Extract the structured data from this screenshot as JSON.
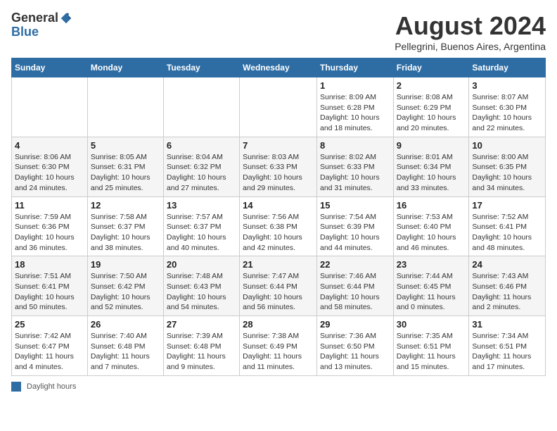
{
  "header": {
    "logo_general": "General",
    "logo_blue": "Blue",
    "month_title": "August 2024",
    "location": "Pellegrini, Buenos Aires, Argentina"
  },
  "days_of_week": [
    "Sunday",
    "Monday",
    "Tuesday",
    "Wednesday",
    "Thursday",
    "Friday",
    "Saturday"
  ],
  "weeks": [
    [
      {
        "day": "",
        "info": ""
      },
      {
        "day": "",
        "info": ""
      },
      {
        "day": "",
        "info": ""
      },
      {
        "day": "",
        "info": ""
      },
      {
        "day": "1",
        "info": "Sunrise: 8:09 AM\nSunset: 6:28 PM\nDaylight: 10 hours and 18 minutes."
      },
      {
        "day": "2",
        "info": "Sunrise: 8:08 AM\nSunset: 6:29 PM\nDaylight: 10 hours and 20 minutes."
      },
      {
        "day": "3",
        "info": "Sunrise: 8:07 AM\nSunset: 6:30 PM\nDaylight: 10 hours and 22 minutes."
      }
    ],
    [
      {
        "day": "4",
        "info": "Sunrise: 8:06 AM\nSunset: 6:30 PM\nDaylight: 10 hours and 24 minutes."
      },
      {
        "day": "5",
        "info": "Sunrise: 8:05 AM\nSunset: 6:31 PM\nDaylight: 10 hours and 25 minutes."
      },
      {
        "day": "6",
        "info": "Sunrise: 8:04 AM\nSunset: 6:32 PM\nDaylight: 10 hours and 27 minutes."
      },
      {
        "day": "7",
        "info": "Sunrise: 8:03 AM\nSunset: 6:33 PM\nDaylight: 10 hours and 29 minutes."
      },
      {
        "day": "8",
        "info": "Sunrise: 8:02 AM\nSunset: 6:33 PM\nDaylight: 10 hours and 31 minutes."
      },
      {
        "day": "9",
        "info": "Sunrise: 8:01 AM\nSunset: 6:34 PM\nDaylight: 10 hours and 33 minutes."
      },
      {
        "day": "10",
        "info": "Sunrise: 8:00 AM\nSunset: 6:35 PM\nDaylight: 10 hours and 34 minutes."
      }
    ],
    [
      {
        "day": "11",
        "info": "Sunrise: 7:59 AM\nSunset: 6:36 PM\nDaylight: 10 hours and 36 minutes."
      },
      {
        "day": "12",
        "info": "Sunrise: 7:58 AM\nSunset: 6:37 PM\nDaylight: 10 hours and 38 minutes."
      },
      {
        "day": "13",
        "info": "Sunrise: 7:57 AM\nSunset: 6:37 PM\nDaylight: 10 hours and 40 minutes."
      },
      {
        "day": "14",
        "info": "Sunrise: 7:56 AM\nSunset: 6:38 PM\nDaylight: 10 hours and 42 minutes."
      },
      {
        "day": "15",
        "info": "Sunrise: 7:54 AM\nSunset: 6:39 PM\nDaylight: 10 hours and 44 minutes."
      },
      {
        "day": "16",
        "info": "Sunrise: 7:53 AM\nSunset: 6:40 PM\nDaylight: 10 hours and 46 minutes."
      },
      {
        "day": "17",
        "info": "Sunrise: 7:52 AM\nSunset: 6:41 PM\nDaylight: 10 hours and 48 minutes."
      }
    ],
    [
      {
        "day": "18",
        "info": "Sunrise: 7:51 AM\nSunset: 6:41 PM\nDaylight: 10 hours and 50 minutes."
      },
      {
        "day": "19",
        "info": "Sunrise: 7:50 AM\nSunset: 6:42 PM\nDaylight: 10 hours and 52 minutes."
      },
      {
        "day": "20",
        "info": "Sunrise: 7:48 AM\nSunset: 6:43 PM\nDaylight: 10 hours and 54 minutes."
      },
      {
        "day": "21",
        "info": "Sunrise: 7:47 AM\nSunset: 6:44 PM\nDaylight: 10 hours and 56 minutes."
      },
      {
        "day": "22",
        "info": "Sunrise: 7:46 AM\nSunset: 6:44 PM\nDaylight: 10 hours and 58 minutes."
      },
      {
        "day": "23",
        "info": "Sunrise: 7:44 AM\nSunset: 6:45 PM\nDaylight: 11 hours and 0 minutes."
      },
      {
        "day": "24",
        "info": "Sunrise: 7:43 AM\nSunset: 6:46 PM\nDaylight: 11 hours and 2 minutes."
      }
    ],
    [
      {
        "day": "25",
        "info": "Sunrise: 7:42 AM\nSunset: 6:47 PM\nDaylight: 11 hours and 4 minutes."
      },
      {
        "day": "26",
        "info": "Sunrise: 7:40 AM\nSunset: 6:48 PM\nDaylight: 11 hours and 7 minutes."
      },
      {
        "day": "27",
        "info": "Sunrise: 7:39 AM\nSunset: 6:48 PM\nDaylight: 11 hours and 9 minutes."
      },
      {
        "day": "28",
        "info": "Sunrise: 7:38 AM\nSunset: 6:49 PM\nDaylight: 11 hours and 11 minutes."
      },
      {
        "day": "29",
        "info": "Sunrise: 7:36 AM\nSunset: 6:50 PM\nDaylight: 11 hours and 13 minutes."
      },
      {
        "day": "30",
        "info": "Sunrise: 7:35 AM\nSunset: 6:51 PM\nDaylight: 11 hours and 15 minutes."
      },
      {
        "day": "31",
        "info": "Sunrise: 7:34 AM\nSunset: 6:51 PM\nDaylight: 11 hours and 17 minutes."
      }
    ]
  ],
  "footer": {
    "legend_label": "Daylight hours"
  }
}
